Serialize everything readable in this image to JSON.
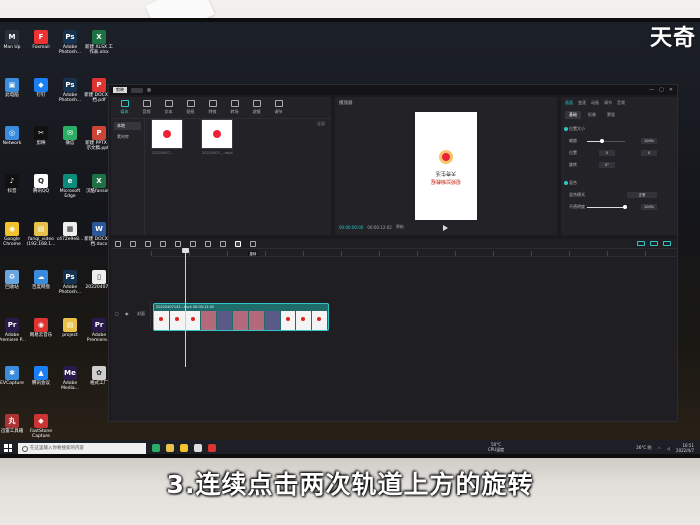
{
  "watermark": "天奇",
  "subtitle": "3.连续点击两次轨道上方的旋转",
  "desktop": {
    "icons": [
      {
        "label": "Man Up",
        "color": "#2a2f3a",
        "glyph": "M"
      },
      {
        "label": "Foxmail",
        "color": "#e33",
        "glyph": "F"
      },
      {
        "label": "Adobe Photosh...",
        "color": "#16324f",
        "glyph": "Ps"
      },
      {
        "label": "新建 XLSX 工作表.xlsx",
        "color": "#1e7145",
        "glyph": "X"
      },
      {
        "label": "此电脑",
        "color": "#3a8dde",
        "glyph": "▣"
      },
      {
        "label": "钉钉",
        "color": "#1a7ef4",
        "glyph": "◆"
      },
      {
        "label": "Adobe Photosh...",
        "color": "#16324f",
        "glyph": "Ps"
      },
      {
        "label": "新建 DOCX 文档.pdf",
        "color": "#d33",
        "glyph": "P"
      },
      {
        "label": "Network",
        "color": "#3a8dde",
        "glyph": "◎"
      },
      {
        "label": "剪映",
        "color": "#111",
        "glyph": "✂"
      },
      {
        "label": "微信",
        "color": "#2aae67",
        "glyph": "✉"
      },
      {
        "label": "新建 PPTX 演示文稿.pptx",
        "color": "#c43",
        "glyph": "P"
      },
      {
        "label": "抖音",
        "color": "#111",
        "glyph": "♪"
      },
      {
        "label": "腾讯QQ",
        "color": "#fff",
        "glyph": "Q"
      },
      {
        "label": "Microsoft Edge",
        "color": "#0d8b7a",
        "glyph": "e"
      },
      {
        "label": "汉酷fansotu",
        "color": "#1e7145",
        "glyph": "X"
      },
      {
        "label": "Google Chrome",
        "color": "#f2c12e",
        "glyph": "◉"
      },
      {
        "label": "fanqi_video (192.168.1...",
        "color": "#e8c14a",
        "glyph": "▤"
      },
      {
        "label": "c472e9e8...",
        "color": "#eee",
        "glyph": "▦"
      },
      {
        "label": "新建 DOCX 文档.docx",
        "color": "#2b5797",
        "glyph": "W"
      },
      {
        "label": "回收站",
        "color": "#6aa6de",
        "glyph": "♻"
      },
      {
        "label": "百度网盘",
        "color": "#3a8dde",
        "glyph": "☁"
      },
      {
        "label": "Adobe Photosh...",
        "color": "#16324f",
        "glyph": "Ps"
      },
      {
        "label": "20220407...",
        "color": "#eee",
        "glyph": "▯"
      },
      {
        "label": "Adobe Premiere P...",
        "color": "#2a1a4a",
        "glyph": "Pr"
      },
      {
        "label": "网易云音乐",
        "color": "#d33",
        "glyph": "◉"
      },
      {
        "label": "project",
        "color": "#e8c14a",
        "glyph": "▤"
      },
      {
        "label": "Adobe Premiere...",
        "color": "#2a1a4a",
        "glyph": "Pr"
      },
      {
        "label": "EVCapture",
        "color": "#3a8dde",
        "glyph": "✱"
      },
      {
        "label": "腾讯会议",
        "color": "#1a7ef4",
        "glyph": "▲"
      },
      {
        "label": "Adobe Media...",
        "color": "#2a1a4a",
        "glyph": "Me"
      },
      {
        "label": "格式工厂",
        "color": "#cfcfcf",
        "glyph": "✿"
      },
      {
        "label": "迅雷工具箱",
        "color": "#a33",
        "glyph": "丸"
      },
      {
        "label": "FastStone Capture",
        "color": "#c33",
        "glyph": "◆"
      }
    ]
  },
  "app": {
    "logo": "剪映",
    "media_tabs": [
      {
        "label": "媒体",
        "active": true
      },
      {
        "label": "音频",
        "active": false
      },
      {
        "label": "文本",
        "active": false
      },
      {
        "label": "贴纸",
        "active": false
      },
      {
        "label": "特效",
        "active": false
      },
      {
        "label": "转场",
        "active": false
      },
      {
        "label": "滤镜",
        "active": false
      },
      {
        "label": "调节",
        "active": false
      }
    ],
    "media_side": [
      {
        "label": "本地",
        "active": true
      },
      {
        "label": "素材库",
        "active": false
      }
    ],
    "import_label": "导入",
    "sort_label": "全部",
    "thumbs": [
      {
        "caption": "20220407...",
        "duration": "00:12"
      },
      {
        "caption": "20220407_...mp4",
        "duration": "00:12"
      }
    ],
    "player": {
      "title": "播放器",
      "frame_line1": "天奇生活",
      "frame_line2": "视频剪辑教程",
      "current_time": "00:00:00:00",
      "total_time": "00:00:12:02",
      "ratio_label": "原始"
    },
    "props": {
      "tabs": [
        "画面",
        "变速",
        "动画",
        "调节",
        "音频"
      ],
      "active_tab": 0,
      "subtabs": [
        "基础",
        "抠像",
        "蒙版"
      ],
      "active_subtab": 0,
      "section1": "位置大小",
      "scale_label": "缩放",
      "scale_value": "100%",
      "scale_fill": 0.4,
      "pos_label": "位置",
      "pos_x": "0",
      "pos_y": "0",
      "rotate_label": "旋转",
      "rotate_value": "0°",
      "section2": "混合",
      "blend_label": "混合模式",
      "blend_value": "正常",
      "opacity_label": "不透明度",
      "opacity_value": "100%",
      "opacity_fill": 1.0
    },
    "timeline": {
      "tooltip": "旋转",
      "track_label": "封面",
      "clip_caption": "20220407143...mp4  00:00:12:02",
      "frames": [
        "light",
        "light",
        "light",
        "dark",
        "dark2",
        "dark",
        "dark",
        "dark2",
        "light",
        "light",
        "light"
      ]
    }
  },
  "taskbar": {
    "search_placeholder": "在这里输入你要搜索的内容",
    "weather_temp": "50°C",
    "weather_label": "CPU温度",
    "tray_temp": "26°C 阴",
    "time": "16:51",
    "date": "2022/4/7"
  }
}
